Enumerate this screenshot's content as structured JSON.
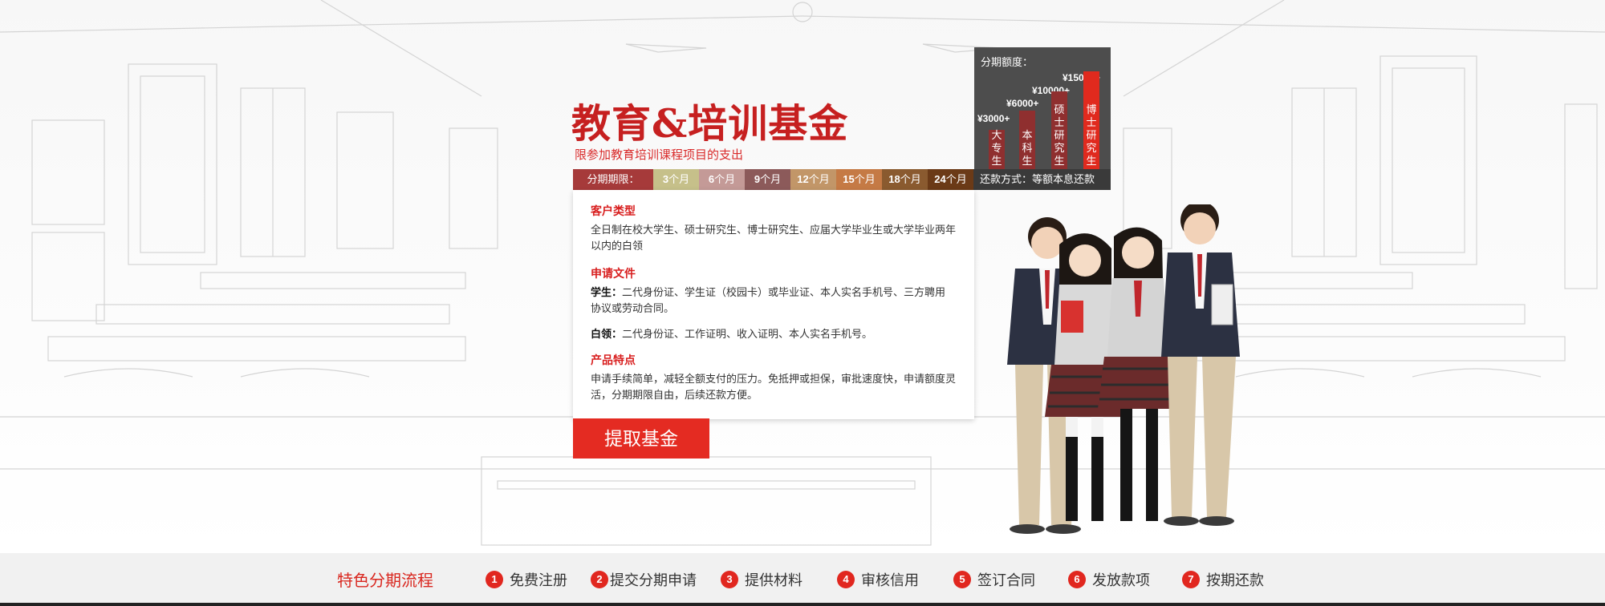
{
  "banner": {
    "title": "教育&培训基金",
    "subtitle": "限参加教育培训课程项目的支出"
  },
  "installment_limit": {
    "label": "分期期限：",
    "terms": [
      {
        "num": "3",
        "unit": "个月",
        "color": "#c6c08a"
      },
      {
        "num": "6",
        "unit": "个月",
        "color": "#c49a97"
      },
      {
        "num": "9",
        "unit": "个月",
        "color": "#8c5a5a"
      },
      {
        "num": "12",
        "unit": "个月",
        "color": "#c29668"
      },
      {
        "num": "15",
        "unit": "个月",
        "color": "#c57a45"
      },
      {
        "num": "18",
        "unit": "个月",
        "color": "#8a5a2f"
      },
      {
        "num": "24",
        "unit": "个月",
        "color": "#6b3a17"
      }
    ],
    "repayment": "还款方式：等额本息还款"
  },
  "amount_panel": {
    "title": "分期额度：",
    "levels": [
      {
        "amount": "¥3000+",
        "label": "大专生",
        "level": 0.32
      },
      {
        "amount": "¥6000+",
        "label": "本科生",
        "level": 0.48
      },
      {
        "amount": "¥10000+",
        "label": "硕士研究生",
        "level": 0.64
      },
      {
        "amount": "¥15000+",
        "label": "博士研究生",
        "level": 0.8
      }
    ],
    "colors": {
      "normal": "#8f2f2f",
      "highlight": "#e02a1e"
    }
  },
  "info": {
    "customer_heading": "客户类型",
    "customer_text": "全日制在校大学生、硕士研究生、博士研究生、应届大学毕业生或大学毕业两年以内的白领",
    "docs_heading": "申请文件",
    "student_label": "学生：",
    "student_text": "二代身份证、学生证（校园卡）或毕业证、本人实名手机号、三方聘用协议或劳动合同。",
    "white_collar_label": "白领：",
    "white_collar_text": "二代身份证、工作证明、收入证明、本人实名手机号。",
    "features_heading": "产品特点",
    "features_text": "申请手续简单，减轻全额支付的压力。免抵押或担保，审批速度快，申请额度灵活，分期期限自由，后续还款方便。"
  },
  "cta": {
    "label": "提取基金"
  },
  "process": {
    "title": "特色分期流程",
    "steps": [
      {
        "num": "1",
        "label": "免费注册"
      },
      {
        "num": "2",
        "label": "提交分期申请"
      },
      {
        "num": "3",
        "label": "提供材料"
      },
      {
        "num": "4",
        "label": "审核信用"
      },
      {
        "num": "5",
        "label": "签订合同"
      },
      {
        "num": "6",
        "label": "发放款项"
      },
      {
        "num": "7",
        "label": "按期还款"
      }
    ]
  },
  "colors": {
    "brand_red": "#e42b22",
    "title_red": "#c62020",
    "dark_panel": "#4d4d4d"
  }
}
